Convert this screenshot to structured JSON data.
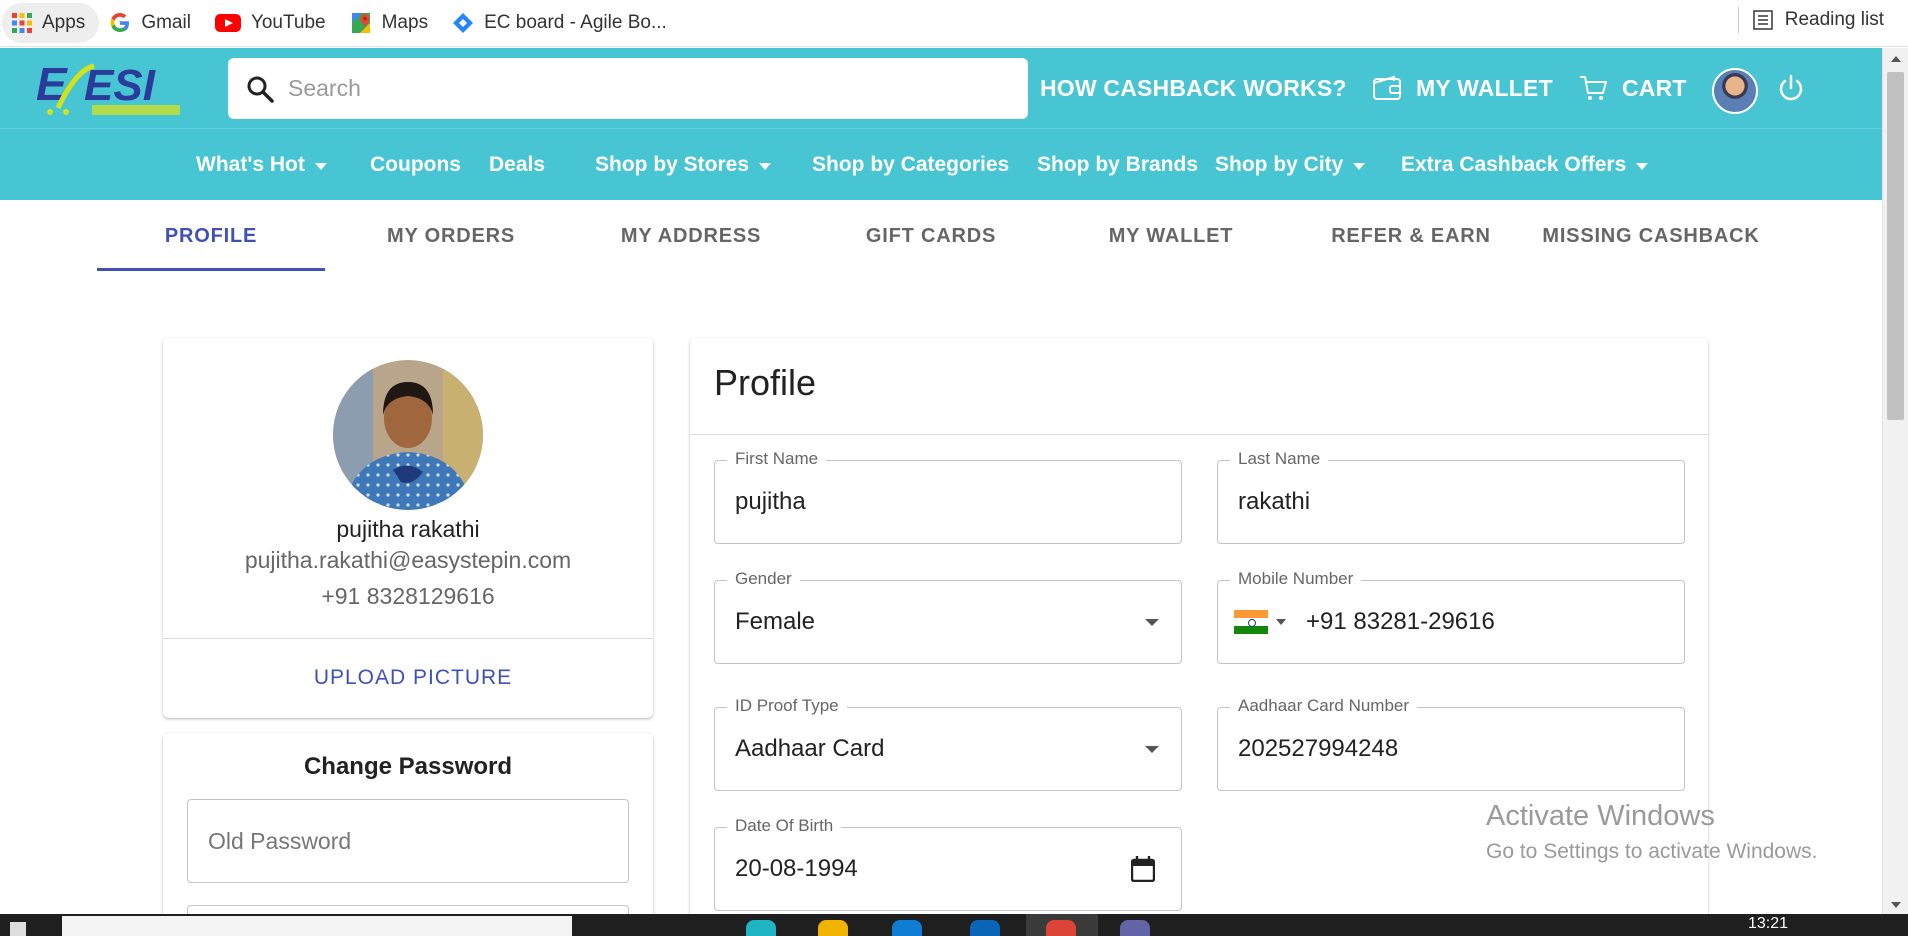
{
  "bookmarks": {
    "items": [
      {
        "label": "Apps"
      },
      {
        "label": "Gmail"
      },
      {
        "label": "YouTube"
      },
      {
        "label": "Maps"
      },
      {
        "label": "EC board - Agile Bo..."
      }
    ],
    "reading_list": "Reading list"
  },
  "header": {
    "search_placeholder": "Search",
    "how_cashback": "HOW CASHBACK WORKS?",
    "wallet": "MY WALLET",
    "cart": "CART"
  },
  "categories": [
    {
      "label": "What's Hot",
      "dropdown": true
    },
    {
      "label": "Coupons",
      "dropdown": false
    },
    {
      "label": "Deals",
      "dropdown": false
    },
    {
      "label": "Shop by Stores",
      "dropdown": true
    },
    {
      "label": "Shop by Categories",
      "dropdown": false
    },
    {
      "label": "Shop by Brands",
      "dropdown": false
    },
    {
      "label": "Shop by City",
      "dropdown": true
    },
    {
      "label": "Extra Cashback Offers",
      "dropdown": true
    }
  ],
  "tabs": [
    {
      "label": "PROFILE",
      "active": true
    },
    {
      "label": "MY ORDERS",
      "active": false
    },
    {
      "label": "MY ADDRESS",
      "active": false
    },
    {
      "label": "GIFT CARDS",
      "active": false
    },
    {
      "label": "MY WALLET",
      "active": false
    },
    {
      "label": "REFER & EARN",
      "active": false
    },
    {
      "label": "MISSING CASHBACK",
      "active": false
    }
  ],
  "user": {
    "name": "pujitha rakathi",
    "email": "pujitha.rakathi@easystepin.com",
    "phone": "+91 8328129616",
    "upload": "UPLOAD PICTURE"
  },
  "change_password": {
    "title": "Change Password",
    "old_placeholder": "Old Password"
  },
  "profile": {
    "title": "Profile",
    "first_name": {
      "label": "First Name",
      "value": "pujitha"
    },
    "last_name": {
      "label": "Last Name",
      "value": "rakathi"
    },
    "gender": {
      "label": "Gender",
      "value": "Female"
    },
    "mobile": {
      "label": "Mobile Number",
      "value": "+91 83281-29616"
    },
    "id_proof": {
      "label": "ID Proof Type",
      "value": "Aadhaar Card"
    },
    "aadhaar": {
      "label": "Aadhaar Card Number",
      "value": "202527994248"
    },
    "dob": {
      "label": "Date Of Birth",
      "value": "20-08-1994"
    }
  },
  "watermark": {
    "line1": "Activate Windows",
    "line2": "Go to Settings to activate Windows."
  },
  "taskbar": {
    "time": "13:21"
  },
  "colors": {
    "brand_teal": "#48c5d2",
    "tab_active": "#3f51b5",
    "link_blue": "#3f51b5"
  }
}
